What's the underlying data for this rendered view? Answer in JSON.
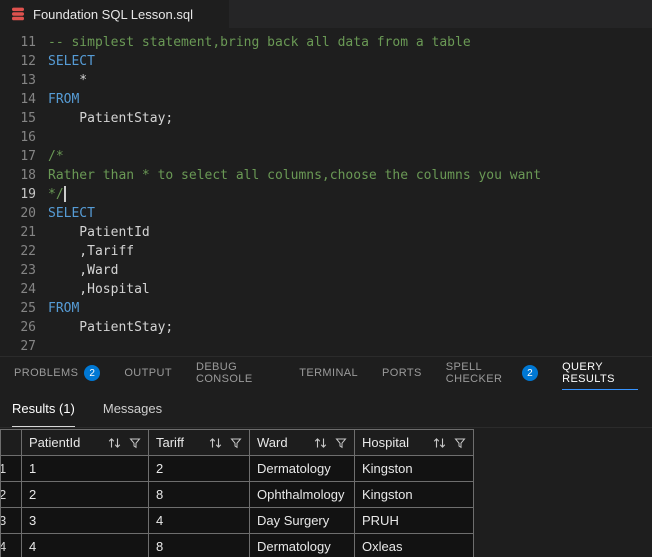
{
  "window": {
    "tab_title": "Foundation SQL Lesson.sql"
  },
  "editor": {
    "lines": [
      {
        "n": "11",
        "cls": "comment",
        "text": "-- simplest statement,bring back all data from a table"
      },
      {
        "n": "12",
        "cls": "keyword",
        "text": "SELECT"
      },
      {
        "n": "13",
        "cls": "plain",
        "text": "    *"
      },
      {
        "n": "14",
        "cls": "keyword",
        "text": "FROM"
      },
      {
        "n": "15",
        "cls": "plain",
        "text": "    PatientStay;"
      },
      {
        "n": "16",
        "cls": "plain",
        "text": ""
      },
      {
        "n": "17",
        "cls": "comment",
        "text": "/*"
      },
      {
        "n": "18",
        "cls": "comment",
        "text": "Rather than * to select all columns,choose the columns you want"
      },
      {
        "n": "19",
        "cls": "comment",
        "text": "*/",
        "active": true,
        "cursor": true
      },
      {
        "n": "20",
        "cls": "keyword",
        "text": "SELECT"
      },
      {
        "n": "21",
        "cls": "plain",
        "text": "    PatientId"
      },
      {
        "n": "22",
        "cls": "plain",
        "text": "    ,Tariff"
      },
      {
        "n": "23",
        "cls": "plain",
        "text": "    ,Ward"
      },
      {
        "n": "24",
        "cls": "plain",
        "text": "    ,Hospital"
      },
      {
        "n": "25",
        "cls": "keyword",
        "text": "FROM"
      },
      {
        "n": "26",
        "cls": "plain",
        "text": "    PatientStay;"
      },
      {
        "n": "27",
        "cls": "plain",
        "text": ""
      }
    ]
  },
  "panel": {
    "tabs": [
      {
        "label": "PROBLEMS",
        "badge": "2"
      },
      {
        "label": "OUTPUT"
      },
      {
        "label": "DEBUG CONSOLE"
      },
      {
        "label": "TERMINAL"
      },
      {
        "label": "PORTS"
      },
      {
        "label": "SPELL CHECKER",
        "badge": "2"
      },
      {
        "label": "QUERY RESULTS",
        "active": true
      }
    ]
  },
  "results": {
    "tabs": [
      {
        "label": "Results (1)",
        "active": true
      },
      {
        "label": "Messages"
      }
    ],
    "grid": {
      "columns": [
        {
          "label": "PatientId"
        },
        {
          "label": "Tariff"
        },
        {
          "label": "Ward"
        },
        {
          "label": "Hospital"
        }
      ],
      "column_icons": [
        "sort-icon",
        "filter-icon"
      ],
      "rows": [
        {
          "num": "1",
          "cells": [
            "1",
            "2",
            "Dermatology",
            "Kingston"
          ]
        },
        {
          "num": "2",
          "cells": [
            "2",
            "8",
            "Ophthalmology",
            "Kingston"
          ]
        },
        {
          "num": "3",
          "cells": [
            "3",
            "4",
            "Day Surgery",
            "PRUH"
          ]
        },
        {
          "num": "4",
          "cells": [
            "4",
            "8",
            "Dermatology",
            "Oxleas"
          ]
        }
      ]
    }
  },
  "colors": {
    "accent": "#3794ff",
    "badge": "#0078d4",
    "keyword": "#569cd6",
    "comment": "#6a9955",
    "file_icon": "#e0524e"
  }
}
